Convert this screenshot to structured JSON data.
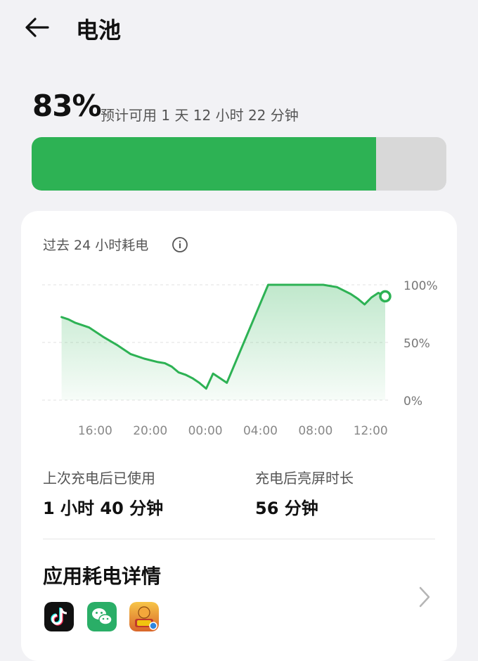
{
  "header": {
    "title": "电池"
  },
  "battery": {
    "percent_text": "83%",
    "level": 0.83,
    "estimate": "预计可用 1 天 12 小时 22 分钟"
  },
  "usage_chart": {
    "title": "过去 24 小时耗电",
    "y_ticks": [
      "100%",
      "50%",
      "0%"
    ],
    "x_ticks": [
      "16:00",
      "20:00",
      "00:00",
      "04:00",
      "08:00",
      "12:00"
    ]
  },
  "chart_data": {
    "type": "area",
    "title": "过去 24 小时耗电",
    "xlabel": "",
    "ylabel": "",
    "ylim": [
      0,
      100
    ],
    "x_unit": "hours_since_12:00",
    "x": [
      1.0,
      1.5,
      2.0,
      3.0,
      4.0,
      5.0,
      6.0,
      7.0,
      8.0,
      8.5,
      9.0,
      9.5,
      10.0,
      10.5,
      11.0,
      11.5,
      12.0,
      12.5,
      13.0,
      16.0,
      20.0,
      21.0,
      22.0,
      22.5,
      23.0,
      23.5,
      24.0,
      24.5
    ],
    "values": [
      72,
      70,
      67,
      63,
      55,
      48,
      40,
      36,
      33,
      32,
      29,
      24,
      22,
      19,
      15,
      10,
      23,
      19,
      15,
      100,
      100,
      98,
      92,
      88,
      83,
      89,
      93,
      90
    ],
    "series": [
      {
        "values": [
          72,
          70,
          67,
          63,
          55,
          48,
          40,
          36,
          33,
          32,
          29,
          24,
          22,
          19,
          15,
          10,
          23,
          19,
          15,
          100,
          100,
          98,
          92,
          88,
          83,
          89,
          93,
          90
        ]
      }
    ],
    "grid": true,
    "colors": {
      "line": "#2db254",
      "fill": "#2db254"
    }
  },
  "stats": {
    "since_charge_label": "上次充电后已使用",
    "since_charge_value": "1 小时 40 分钟",
    "screen_on_label": "充电后亮屏时长",
    "screen_on_value": "56 分钟"
  },
  "apps": {
    "title": "应用耗电详情",
    "icons": [
      "tiktok-icon",
      "wechat-icon",
      "game-icon"
    ]
  },
  "colors": {
    "accent": "#2db254",
    "track": "#d8d8d8",
    "background": "#f2f2f5"
  }
}
